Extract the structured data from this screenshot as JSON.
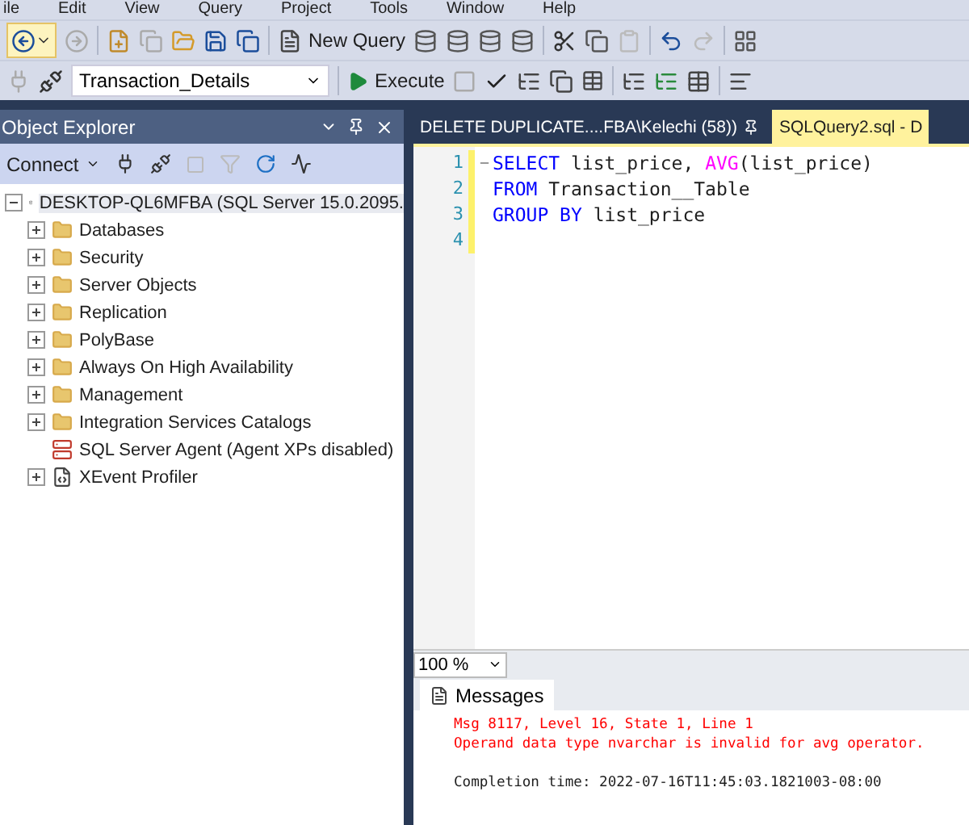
{
  "menu": [
    "ile",
    "Edit",
    "View",
    "Query",
    "Project",
    "Tools",
    "Window",
    "Help"
  ],
  "toolbar_1": {
    "new_query": "New Query"
  },
  "toolbar_2": {
    "database": "Transaction_Details",
    "execute": "Execute"
  },
  "object_explorer": {
    "title": "Object Explorer",
    "connect": "Connect",
    "tree": {
      "label": "DESKTOP-QL6MFBA (SQL Server 15.0.2095.",
      "expanded": true,
      "selected": true,
      "children": [
        {
          "label": "Databases",
          "kind": "folder",
          "expandable": true
        },
        {
          "label": "Security",
          "kind": "folder",
          "expandable": true
        },
        {
          "label": "Server Objects",
          "kind": "folder",
          "expandable": true
        },
        {
          "label": "Replication",
          "kind": "folder",
          "expandable": true
        },
        {
          "label": "PolyBase",
          "kind": "folder",
          "expandable": true
        },
        {
          "label": "Always On High Availability",
          "kind": "folder",
          "expandable": true
        },
        {
          "label": "Management",
          "kind": "folder",
          "expandable": true
        },
        {
          "label": "Integration Services Catalogs",
          "kind": "folder",
          "expandable": true
        },
        {
          "label": "SQL Server Agent (Agent XPs disabled)",
          "kind": "agent",
          "expandable": false
        },
        {
          "label": "XEvent Profiler",
          "kind": "profiler",
          "expandable": true
        }
      ]
    }
  },
  "editor_tabs": [
    {
      "label": "DELETE DUPLICATE....FBA\\Kelechi (58))",
      "selected": false
    },
    {
      "label": "SQLQuery2.sql - D",
      "selected": true
    }
  ],
  "code_lines": [
    {
      "number": "1",
      "tokens": [
        {
          "text": "SELECT",
          "kind": "keyword"
        },
        {
          "text": " list_price, ",
          "kind": "plain"
        },
        {
          "text": "AVG",
          "kind": "function"
        },
        {
          "text": "(list_price)",
          "kind": "plain"
        }
      ]
    },
    {
      "number": "2",
      "tokens": [
        {
          "text": "FROM",
          "kind": "keyword"
        },
        {
          "text": " Transaction__Table",
          "kind": "plain"
        }
      ]
    },
    {
      "number": "3",
      "tokens": [
        {
          "text": "GROUP BY",
          "kind": "keyword"
        },
        {
          "text": " list_price",
          "kind": "plain"
        }
      ]
    },
    {
      "number": "4"
    }
  ],
  "zoom": "100 %",
  "results_tab": "Messages",
  "messages": [
    {
      "text": "Msg 8117, Level 16, State 1, Line 1",
      "kind": "error"
    },
    {
      "text": "Operand data type nvarchar is invalid for avg operator.",
      "kind": "error"
    },
    {
      "text": "Completion time: 2022-07-16T11:45:03.1821003-08:00",
      "kind": "info"
    }
  ]
}
